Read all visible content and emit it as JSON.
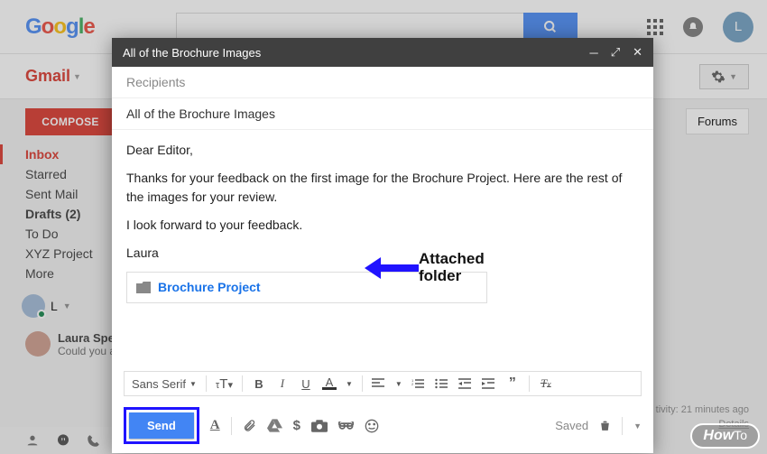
{
  "header": {
    "logo_text": "Google",
    "search_placeholder": "",
    "avatar_letter": "L"
  },
  "subbar": {
    "product": "Gmail"
  },
  "sidebar": {
    "compose_label": "COMPOSE",
    "labels": [
      "Inbox",
      "Starred",
      "Sent Mail",
      "Drafts (2)",
      "To Do",
      "XYZ Project",
      "More"
    ],
    "hangout_user": "L",
    "chat": {
      "name": "Laura Sper",
      "snippet": "Could you as"
    }
  },
  "right": {
    "tab_forums": "Forums",
    "activity_line1": "tivity: 21 minutes ago",
    "activity_line2": "Details"
  },
  "compose": {
    "title": "All of the Brochure Images",
    "recipients_placeholder": "Recipients",
    "subject": "All of the Brochure Images",
    "body_greeting": "Dear Editor,",
    "body_p1": "Thanks for your feedback on the first image for the Brochure Project. Here are the rest of the images for your review.",
    "body_p2": "I look forward to your feedback.",
    "body_sign": "Laura",
    "attachment_name": "Brochure Project",
    "annotation_text": "Attached folder",
    "toolbar": {
      "font": "Sans Serif",
      "size_icon": "τT",
      "bold": "B",
      "italic": "I",
      "underline": "U",
      "color": "A"
    },
    "send_label": "Send",
    "saved_label": "Saved"
  },
  "badge": {
    "how": "How",
    "to": "To"
  }
}
